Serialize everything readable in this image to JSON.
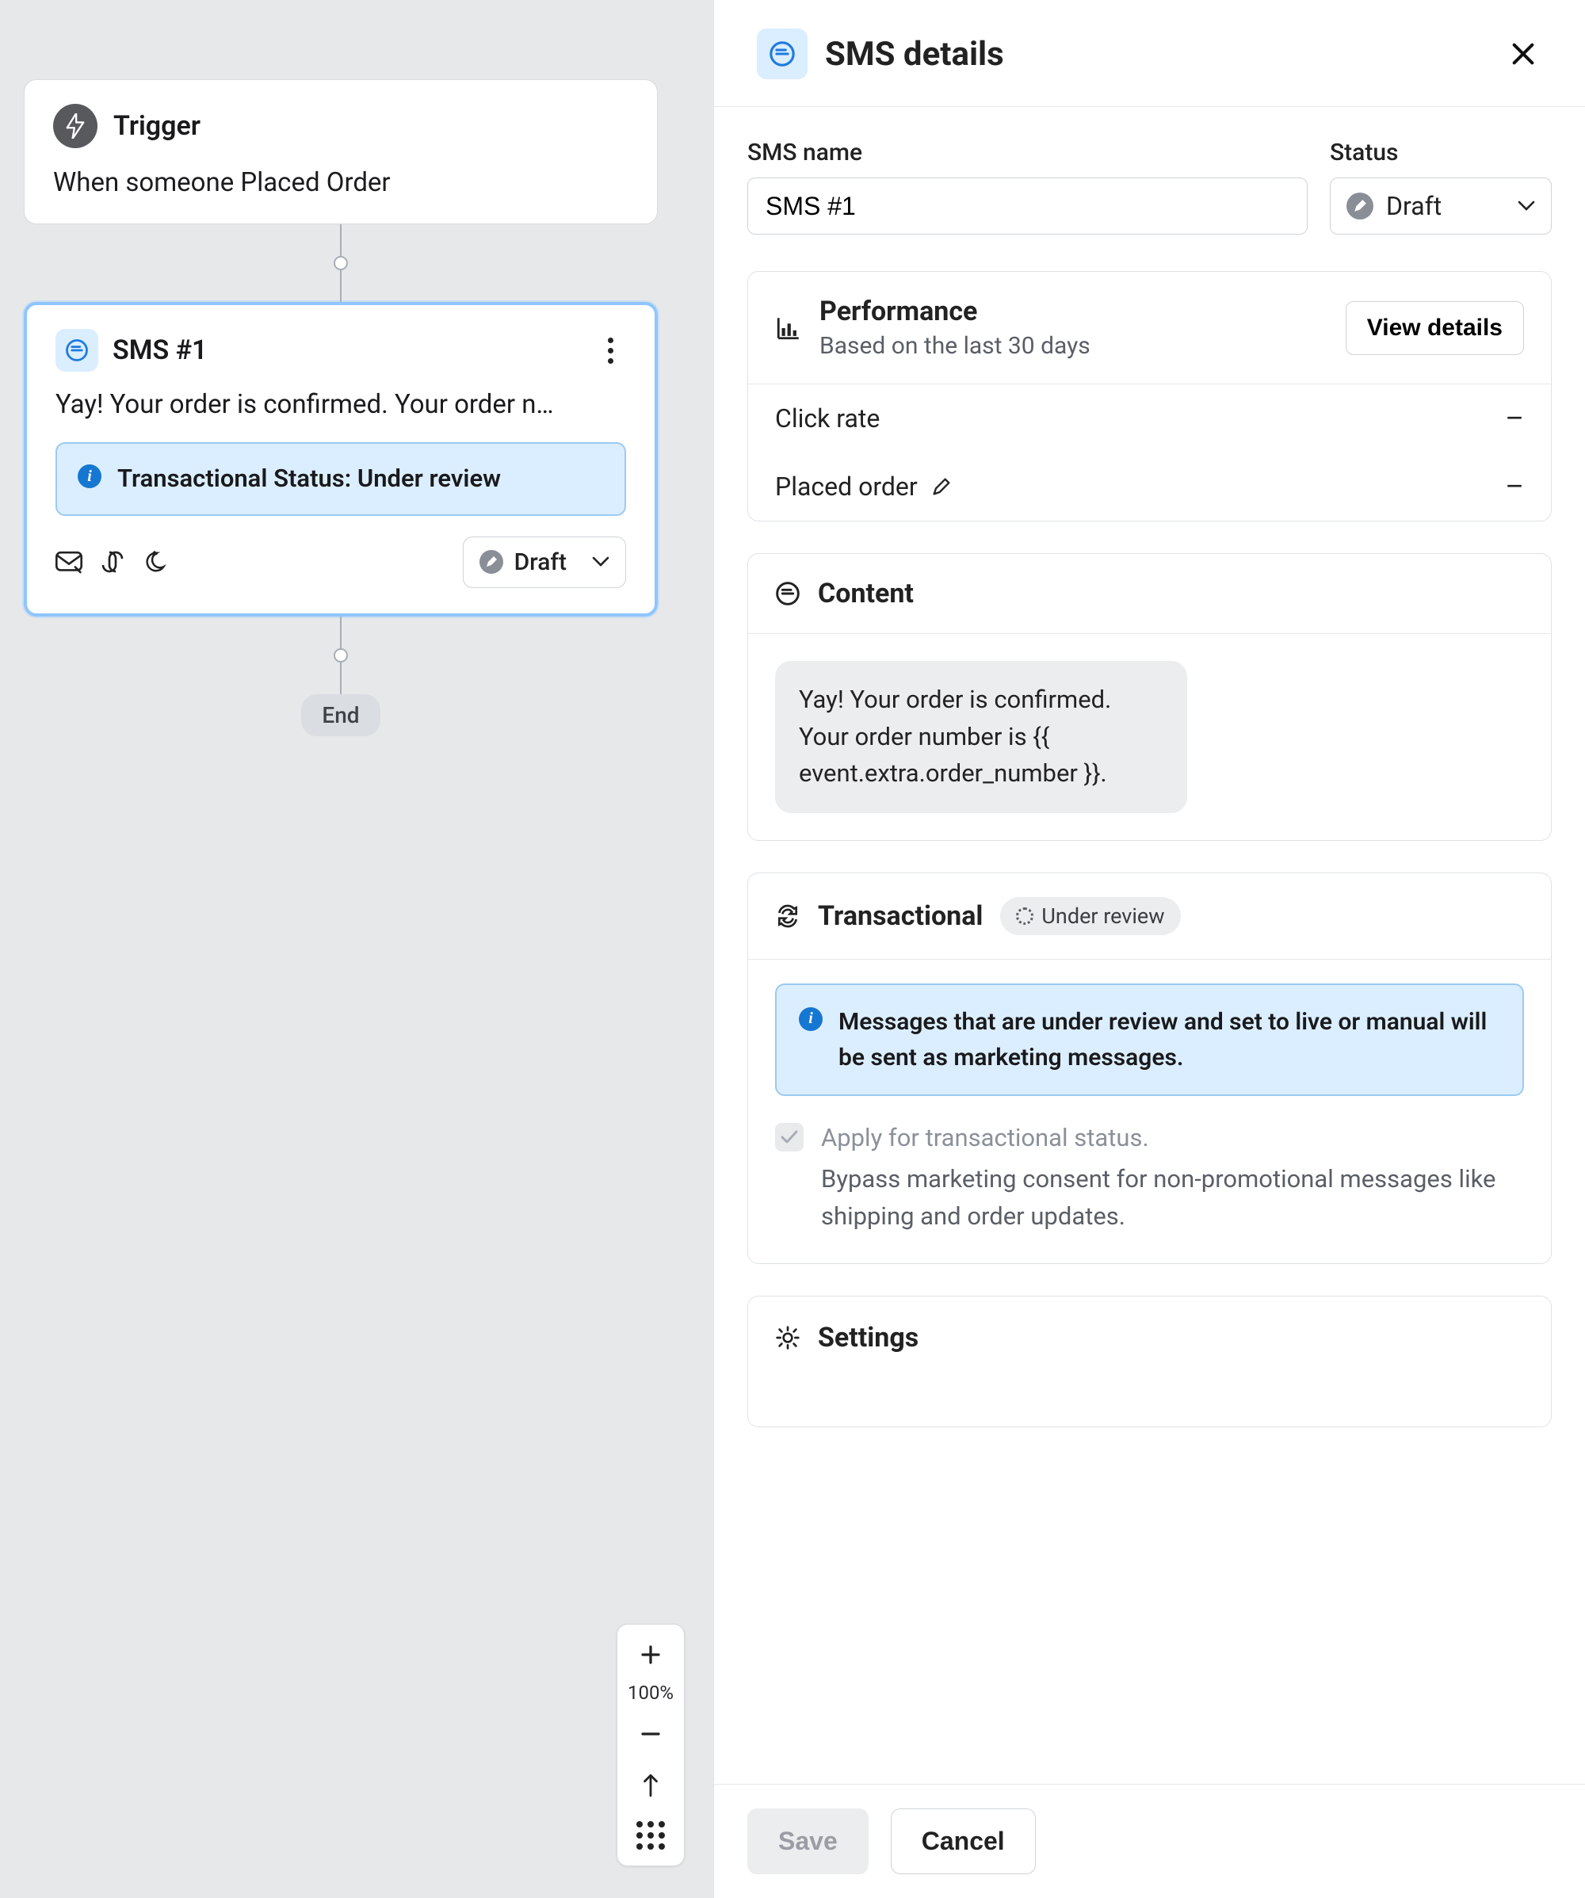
{
  "canvas": {
    "trigger": {
      "title": "Trigger",
      "description": "When someone Placed Order"
    },
    "sms_card": {
      "title": "SMS #1",
      "preview": "Yay! Your order is confirmed. Your order n…",
      "banner": "Transactional Status: Under review",
      "status_label": "Draft"
    },
    "end_label": "End",
    "zoom": {
      "level": "100%"
    }
  },
  "panel": {
    "title": "SMS details",
    "name_field": {
      "label": "SMS name",
      "value": "SMS #1"
    },
    "status_field": {
      "label": "Status",
      "value": "Draft"
    },
    "performance": {
      "title": "Performance",
      "subtitle": "Based on the last 30 days",
      "view_details": "View details",
      "metrics": {
        "click_rate": {
          "label": "Click rate",
          "value": "–"
        },
        "placed_order": {
          "label": "Placed order",
          "value": "–"
        }
      }
    },
    "content": {
      "title": "Content",
      "bubble": "Yay! Your order is confirmed. Your order number is {{ event.extra.order_number }}."
    },
    "transactional": {
      "title": "Transactional",
      "badge": "Under review",
      "callout": "Messages that are under review and set to live or manual will be sent as marketing messages.",
      "apply_title": "Apply for transactional status.",
      "apply_desc": "Bypass marketing consent for non-promotional messages like shipping and order updates."
    },
    "settings": {
      "title": "Settings"
    },
    "footer": {
      "save": "Save",
      "cancel": "Cancel"
    }
  }
}
